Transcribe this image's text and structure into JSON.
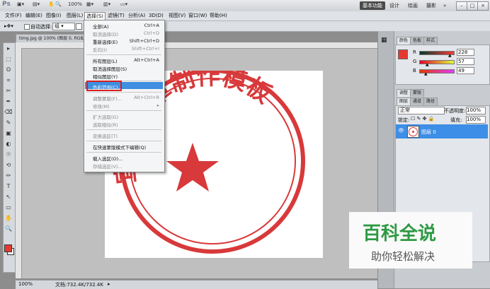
{
  "app": {
    "logo": "Ps",
    "zoom": "100%",
    "workspaces": [
      "基本功能",
      "设计",
      "绘画",
      "摄影"
    ],
    "window_buttons": [
      "–",
      "□",
      "×"
    ]
  },
  "menubar": [
    "文件(F)",
    "编辑(E)",
    "图像(I)",
    "图层(L)",
    "选择(S)",
    "滤镜(T)",
    "分析(A)",
    "3D(D)",
    "视图(V)",
    "窗口(W)",
    "帮助(H)"
  ],
  "options": {
    "auto_select": "自动选择:",
    "auto_select_value": "组"
  },
  "doc_tab": "timg.jpg @ 100% (图层 0, RGB/...",
  "status": {
    "zoom": "100%",
    "doc": "文档:732.4K/732.4K"
  },
  "select_menu": {
    "items": [
      {
        "label": "全部(A)",
        "shortcut": "Ctrl+A",
        "disabled": false
      },
      {
        "label": "取消选择(D)",
        "shortcut": "Ctrl+D",
        "disabled": true
      },
      {
        "label": "重新选择(E)",
        "shortcut": "Shift+Ctrl+D",
        "disabled": false
      },
      {
        "label": "反向(I)",
        "shortcut": "Shift+Ctrl+I",
        "disabled": true
      },
      {
        "label": "所有图层(L)",
        "shortcut": "Alt+Ctrl+A",
        "disabled": false
      },
      {
        "label": "取消选择图层(S)",
        "shortcut": "",
        "disabled": false
      },
      {
        "label": "相似图层(Y)",
        "shortcut": "",
        "disabled": false
      },
      {
        "label": "色彩范围(C)...",
        "shortcut": "",
        "disabled": false
      },
      {
        "label": "调整蒙版(F)...",
        "shortcut": "Alt+Ctrl+R",
        "disabled": true
      },
      {
        "label": "修改(M)",
        "shortcut": "▸",
        "disabled": true
      },
      {
        "label": "扩大选取(G)",
        "shortcut": "",
        "disabled": true
      },
      {
        "label": "选取相似(R)",
        "shortcut": "",
        "disabled": true
      },
      {
        "label": "变换选区(T)",
        "shortcut": "",
        "disabled": true
      },
      {
        "label": "在快速蒙版模式下编辑(Q)",
        "shortcut": "",
        "disabled": false
      },
      {
        "label": "载入选区(O)...",
        "shortcut": "",
        "disabled": false
      },
      {
        "label": "存储选区(V)...",
        "shortcut": "",
        "disabled": true
      }
    ]
  },
  "color_panel": {
    "tabs": [
      "颜色",
      "色板",
      "样式"
    ],
    "channels": [
      {
        "name": "R",
        "value": "228"
      },
      {
        "name": "G",
        "value": "57"
      },
      {
        "name": "B",
        "value": "49"
      }
    ],
    "fg_color": "#e43931"
  },
  "adjust_panel": {
    "tabs": [
      "调整",
      "蒙版"
    ]
  },
  "layers_panel": {
    "tabs": [
      "图层",
      "通道",
      "路径"
    ],
    "blend_mode": "正常",
    "opacity_label": "不透明度:",
    "opacity_value": "100%",
    "lock_label": "锁定:",
    "fill_label": "填充:",
    "fill_value": "100%",
    "layer_name": "图层 0"
  },
  "stamp": {
    "text": "宣 司公章制作模板",
    "color": "#d8393a"
  },
  "watermark": {
    "title": "百科全说",
    "subtitle": "助你轻松解决",
    "title_color": "#2e9a44"
  }
}
